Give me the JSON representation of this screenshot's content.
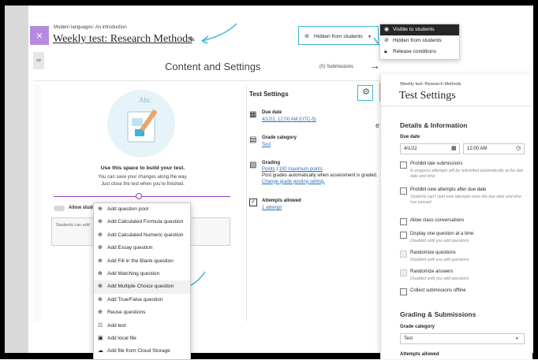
{
  "header": {
    "course": "Modern languages: An introduction",
    "test_title": "Weekly test: Research Methods",
    "visibility_label": "Hidden from students"
  },
  "visibility_menu": {
    "items": [
      {
        "label": "Visible to students",
        "icon": "eye-icon"
      },
      {
        "label": "Hidden from students",
        "icon": "eye-slash-icon"
      },
      {
        "label": "Release conditions",
        "icon": "lock-icon"
      }
    ]
  },
  "content_bar": {
    "title": "Content and Settings",
    "submissions": "(0) Submissions"
  },
  "empty_state": {
    "heading": "Use this space to build your test.",
    "line1": "You can save your changes along the way.",
    "line2": "Just close the test when you're finished.",
    "allow_prefix": "Allow stude",
    "allow_suffix": "nt",
    "students_prefix": "Students can add"
  },
  "add_menu": {
    "items": [
      {
        "label": "Add question pool",
        "icon": "plus-circle-icon"
      },
      {
        "label": "Add Calculated Formula question",
        "icon": "plus-circle-icon"
      },
      {
        "label": "Add Calculated Numeric question",
        "icon": "plus-circle-icon"
      },
      {
        "label": "Add Essay question",
        "icon": "plus-circle-icon"
      },
      {
        "label": "Add Fill in the Blank question",
        "icon": "plus-circle-icon"
      },
      {
        "label": "Add Matching question",
        "icon": "plus-circle-icon"
      },
      {
        "label": "Add Multiple Choice question",
        "icon": "plus-circle-icon"
      },
      {
        "label": "Add True/False question",
        "icon": "plus-circle-icon"
      },
      {
        "label": "Reuse questions",
        "icon": "plus-circle-icon"
      },
      {
        "label": "Add text",
        "icon": "text-icon"
      },
      {
        "label": "Add local file",
        "icon": "file-icon"
      },
      {
        "label": "Add file from Cloud Storage",
        "icon": "cloud-icon"
      }
    ]
  },
  "test_settings_card": {
    "title": "Test Settings",
    "due_date_label": "Due date",
    "due_date_value": "4/1/22, 12:00 AM (UTC-5)",
    "grade_category_label": "Grade category",
    "grade_category_value": "Test",
    "grading_label": "Grading",
    "grading_points": "Points",
    "grading_separator": " | ",
    "grading_max": "100 maximum points",
    "grading_note": "Post grades automatically when assessment is graded.",
    "grading_link": "Change grade posting setting.",
    "attempts_label": "Attempts allowed",
    "attempts_value": "1 attempt"
  },
  "settings_panel": {
    "breadcrumb": "Weekly test: Research Methods",
    "title": "Test Settings",
    "section1": "Details & Information",
    "due_date_label": "Due date",
    "date_value": "4/1/22",
    "time_value": "12:00 AM",
    "checkboxes": [
      {
        "label": "Prohibit late submissions",
        "sub": "In progress attempts will be submitted automatically at the due date and time"
      },
      {
        "label": "Prohibit new attempts after due date",
        "sub": "Students can't start new attempts once the due date and time has passed"
      },
      {
        "label": "Allow class conversations",
        "sub": ""
      },
      {
        "label": "Display one question at a time",
        "sub": "Disabled until you add questions"
      },
      {
        "label": "Randomize questions",
        "sub": "Disabled until you add questions"
      },
      {
        "label": "Randomize answers",
        "sub": "Disabled until you add questions"
      },
      {
        "label": "Collect submissions offline",
        "sub": ""
      }
    ],
    "section2": "Grading & Submissions",
    "grade_category_label": "Grade category",
    "grade_category_value": "Test",
    "attempts_label": "Attempts allowed"
  },
  "colors": {
    "highlight": "#3bb7d6",
    "purple": "#b58ae0",
    "divider_purple": "#8f3fc3",
    "link": "#2a6ebb"
  }
}
